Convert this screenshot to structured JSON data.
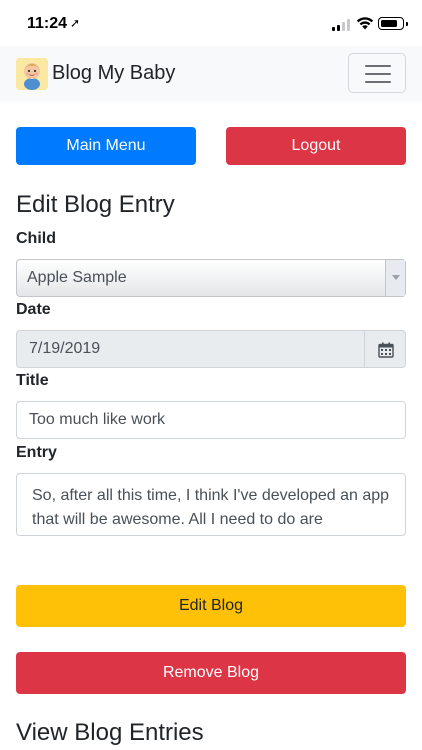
{
  "status_bar": {
    "time": "11:24",
    "location_glyph": "➚"
  },
  "navbar": {
    "brand": "Blog My Baby",
    "logo_icon": "baby-icon",
    "menu_icon": "hamburger-icon"
  },
  "actions": {
    "main_menu": "Main Menu",
    "logout": "Logout"
  },
  "form": {
    "heading": "Edit Blog Entry",
    "child_label": "Child",
    "child_value": "Apple Sample",
    "date_label": "Date",
    "date_value": "7/19/2019",
    "title_label": "Title",
    "title_value": "Too much like work",
    "entry_label": "Entry",
    "entry_value": "So, after all this time, I think I've developed an app that will be awesome.  All I need to do are",
    "edit_button": "Edit Blog",
    "remove_button": "Remove Blog"
  },
  "view_heading": "View Blog Entries",
  "colors": {
    "primary": "#007bff",
    "danger": "#dc3545",
    "warning": "#ffc107",
    "navbar_bg": "#f8f9fa"
  }
}
